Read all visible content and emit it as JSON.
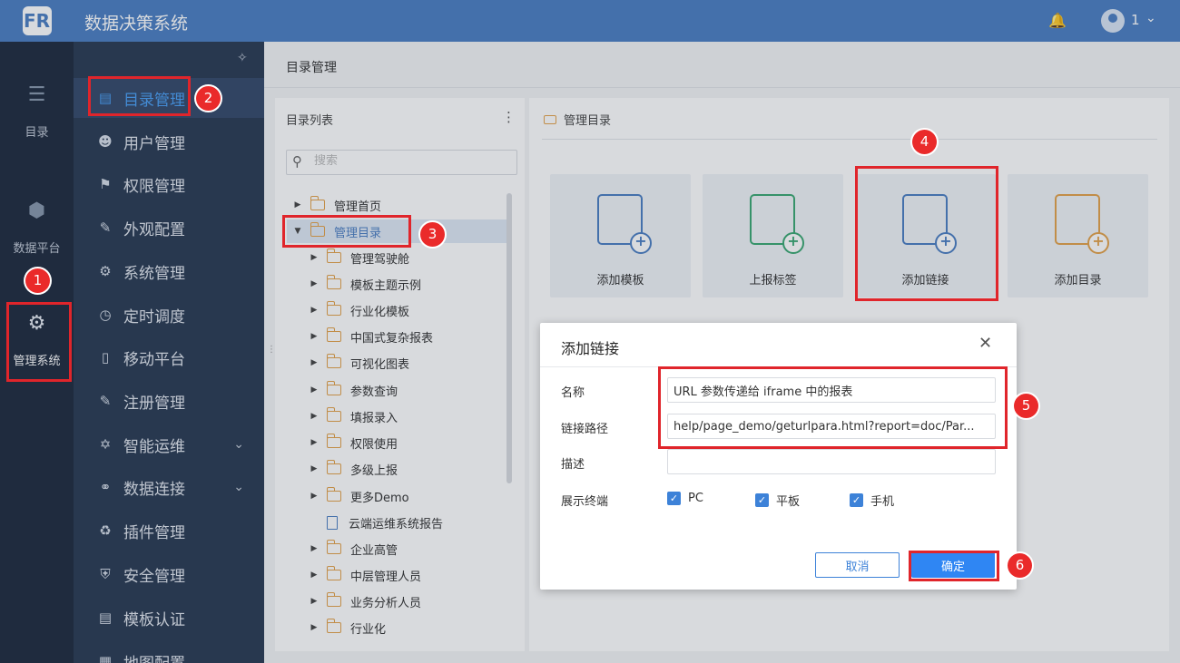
{
  "header": {
    "logo": "FR",
    "app_title": "数据决策系统",
    "user_name": "1",
    "icons": [
      "bell-icon",
      "user-avatar-icon",
      "chevron-down-icon"
    ]
  },
  "rail": {
    "items": [
      {
        "label": "目录",
        "icon": "list-icon"
      },
      {
        "label": "数据平台",
        "icon": "cube-icon"
      },
      {
        "label": "管理系统",
        "icon": "gear-icon",
        "active": true
      }
    ]
  },
  "sidebar": {
    "items": [
      {
        "label": "目录管理",
        "icon": "directory-icon",
        "active": true
      },
      {
        "label": "用户管理",
        "icon": "user-icon"
      },
      {
        "label": "权限管理",
        "icon": "lock-icon"
      },
      {
        "label": "外观配置",
        "icon": "brush-icon"
      },
      {
        "label": "系统管理",
        "icon": "settings-icon"
      },
      {
        "label": "定时调度",
        "icon": "timer-icon"
      },
      {
        "label": "移动平台",
        "icon": "mobile-icon"
      },
      {
        "label": "注册管理",
        "icon": "register-icon"
      },
      {
        "label": "智能运维",
        "icon": "ops-icon",
        "expandable": true
      },
      {
        "label": "数据连接",
        "icon": "link-icon",
        "expandable": true
      },
      {
        "label": "插件管理",
        "icon": "plugin-icon"
      },
      {
        "label": "安全管理",
        "icon": "shield-icon"
      },
      {
        "label": "模板认证",
        "icon": "certificate-icon"
      },
      {
        "label": "地图配置",
        "icon": "map-icon"
      }
    ]
  },
  "breadcrumb": "目录管理",
  "tree_panel": {
    "title": "目录列表",
    "search_placeholder": "搜索",
    "nodes": [
      {
        "label": "管理首页",
        "level": 0,
        "type": "folder",
        "expanded": false
      },
      {
        "label": "管理目录",
        "level": 0,
        "type": "folder",
        "expanded": true,
        "selected": true
      },
      {
        "label": "管理驾驶舱",
        "level": 1,
        "type": "folder"
      },
      {
        "label": "模板主题示例",
        "level": 1,
        "type": "folder"
      },
      {
        "label": "行业化模板",
        "level": 1,
        "type": "folder"
      },
      {
        "label": "中国式复杂报表",
        "level": 1,
        "type": "folder"
      },
      {
        "label": "可视化图表",
        "level": 1,
        "type": "folder"
      },
      {
        "label": "参数查询",
        "level": 1,
        "type": "folder"
      },
      {
        "label": "填报录入",
        "level": 1,
        "type": "folder"
      },
      {
        "label": "权限使用",
        "level": 1,
        "type": "folder"
      },
      {
        "label": "多级上报",
        "level": 1,
        "type": "folder"
      },
      {
        "label": "更多Demo",
        "level": 1,
        "type": "folder"
      },
      {
        "label": "云端运维系统报告",
        "level": 1,
        "type": "file"
      },
      {
        "label": "企业高管",
        "level": 1,
        "type": "folder"
      },
      {
        "label": "中层管理人员",
        "level": 1,
        "type": "folder"
      },
      {
        "label": "业务分析人员",
        "level": 1,
        "type": "folder"
      },
      {
        "label": "行业化",
        "level": 1,
        "type": "folder"
      }
    ]
  },
  "right_panel": {
    "title": "管理目录",
    "actions": [
      {
        "label": "添加模板",
        "color": "#4b7ec2",
        "icon": "add-template-icon"
      },
      {
        "label": "上报标签",
        "color": "#3aa872",
        "icon": "add-report-tag-icon"
      },
      {
        "label": "添加链接",
        "color": "#4b7ec2",
        "icon": "add-link-icon"
      },
      {
        "label": "添加目录",
        "color": "#e3a24a",
        "icon": "add-folder-icon"
      }
    ]
  },
  "dialog": {
    "title": "添加链接",
    "fields": {
      "name_label": "名称",
      "name_value": "URL 参数传递给 iframe 中的报表",
      "path_label": "链接路径",
      "path_value": "help/page_demo/geturlpara.html?report=doc/Par...",
      "desc_label": "描述",
      "desc_value": "",
      "terminal_label": "展示终端"
    },
    "terminals": [
      {
        "label": "PC",
        "checked": true
      },
      {
        "label": "平板",
        "checked": true
      },
      {
        "label": "手机",
        "checked": true
      }
    ],
    "cancel_label": "取消",
    "ok_label": "确定"
  },
  "annotations": [
    "1",
    "2",
    "3",
    "4",
    "5",
    "6"
  ],
  "colors": {
    "header": "#4b7ec2",
    "rail": "#1e2a3e",
    "sidebar": "#293a52",
    "accent": "#2f86f3",
    "annotation": "#e0252b"
  }
}
